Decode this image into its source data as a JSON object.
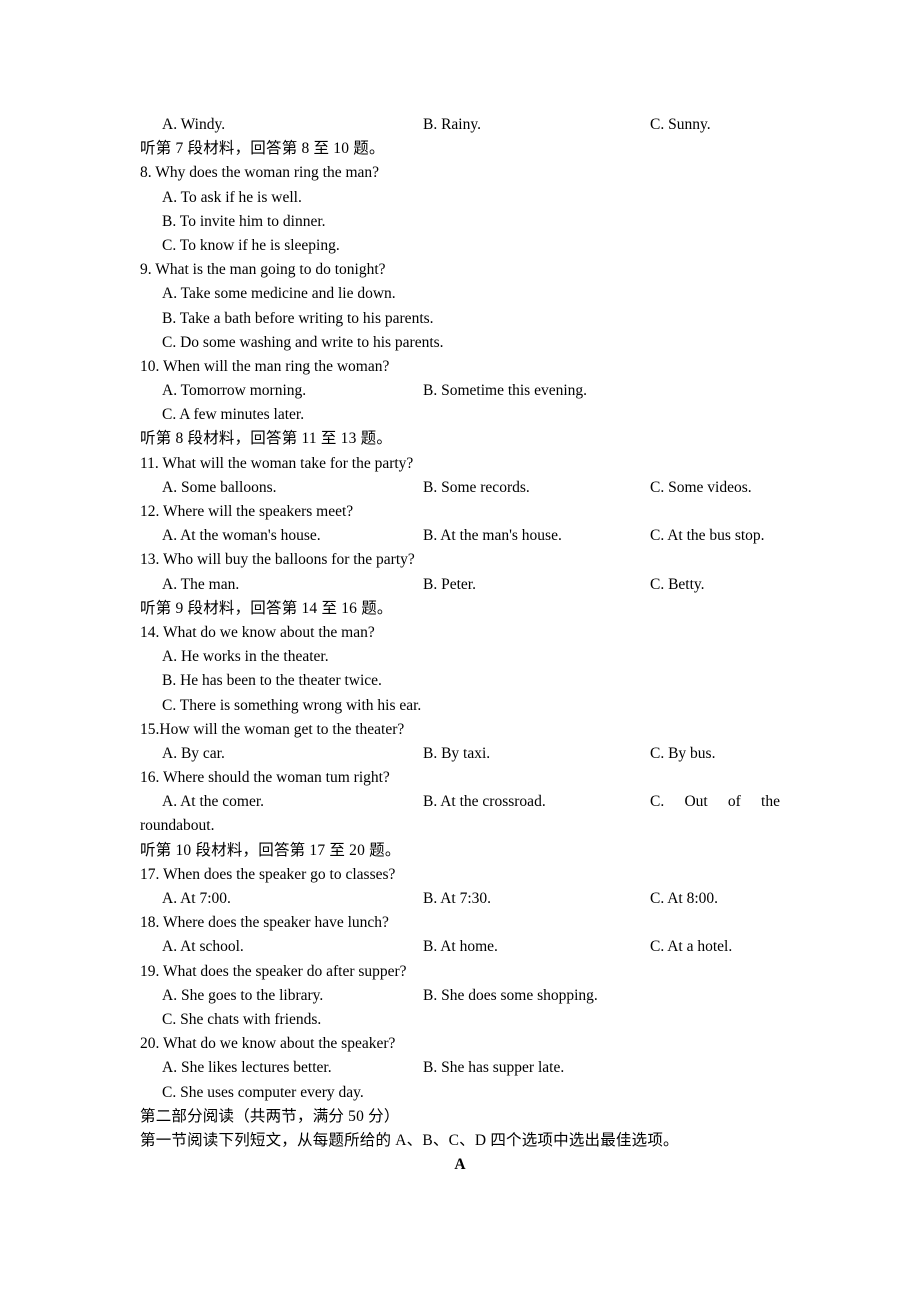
{
  "document": {
    "type": "english-exam-paper",
    "language_mix": "en-zh",
    "background_color": "#ffffff",
    "text_color": "#000000"
  },
  "top_options": {
    "a": "A. Windy.",
    "b": "B. Rainy.",
    "c": "C. Sunny."
  },
  "sections": [
    {
      "id": "material-7",
      "heading": "听第 7 段材料，回答第 8 至 10 题。",
      "questions": [
        {
          "number": "8",
          "stem": "8. Why does the woman ring the man?",
          "layout": "stacked",
          "options": [
            "A. To ask if he is well.",
            "B. To invite him to dinner.",
            "C. To know if he is sleeping."
          ]
        },
        {
          "number": "9",
          "stem": "9. What is the man going to do tonight?",
          "layout": "stacked",
          "options": [
            "A. Take some medicine and lie down.",
            "B. Take a bath before writing to his parents.",
            "C. Do some washing and write to his parents."
          ]
        },
        {
          "number": "10",
          "stem": "10. When will the man ring the woman?",
          "layout": "two-col-then-one",
          "options": [
            "A. Tomorrow morning.",
            "B. Sometime this evening.",
            "C. A few minutes later."
          ]
        }
      ]
    },
    {
      "id": "material-8",
      "heading": "听第 8 段材料，回答第 11 至 13 题。",
      "questions": [
        {
          "number": "11",
          "stem": "11. What will the woman take for the party?",
          "layout": "three-col",
          "options": [
            "A. Some balloons.",
            "B. Some records.",
            "C. Some videos."
          ]
        },
        {
          "number": "12",
          "stem": "12. Where will the speakers meet?",
          "layout": "three-col",
          "options": [
            "A. At the woman's house.",
            "B. At the man's house.",
            "C. At the bus stop."
          ]
        },
        {
          "number": "13",
          "stem": "13. Who will buy the balloons for the party?",
          "layout": "three-col",
          "options": [
            "A. The man.",
            "B. Peter.",
            "C. Betty."
          ]
        }
      ]
    },
    {
      "id": "material-9",
      "heading": "听第 9 段材料，回答第 14 至 16 题。",
      "questions": [
        {
          "number": "14",
          "stem": "14. What do we know about the man?",
          "layout": "stacked",
          "options": [
            "A. He works in the theater.",
            "B. He has been to the theater twice.",
            "C. There is something wrong with his ear."
          ]
        },
        {
          "number": "15",
          "stem": "15.How will the woman get to the theater?",
          "layout": "three-col",
          "options": [
            "A. By car.",
            "B. By taxi.",
            "C. By bus."
          ]
        },
        {
          "number": "16",
          "stem": "16. Where should the woman tum right?",
          "layout": "three-col-wrapped",
          "options": [
            "A. At the comer.",
            "B. At the crossroad.",
            "C. Out of the roundabout."
          ],
          "option_c_justified_words": [
            "C.",
            "Out",
            "of",
            "the"
          ],
          "option_c_wrapped_tail": "roundabout."
        }
      ]
    },
    {
      "id": "material-10",
      "heading": "听第 10 段材料，回答第 17 至 20 题。",
      "questions": [
        {
          "number": "17",
          "stem": "17. When does the speaker go to classes?",
          "layout": "three-col",
          "options": [
            "A. At 7:00.",
            "B. At 7:30.",
            "C. At 8:00."
          ]
        },
        {
          "number": "18",
          "stem": "18. Where does the speaker have lunch?",
          "layout": "three-col",
          "options": [
            "A. At school.",
            "B. At home.",
            "C. At a hotel."
          ]
        },
        {
          "number": "19",
          "stem": "19. What does the speaker do after supper?",
          "layout": "two-col-then-one",
          "options": [
            "A. She goes to the library.",
            "B. She does some shopping.",
            "C. She chats with friends."
          ]
        },
        {
          "number": "20",
          "stem": "20. What do we know about the speaker?",
          "layout": "two-col-then-one",
          "options": [
            "A. She likes lectures better.",
            "B. She has supper late.",
            "C. She uses computer every day."
          ]
        }
      ]
    }
  ],
  "part_two": {
    "part_heading": "第二部分阅读（共两节，满分 50 分）",
    "section_heading": "第一节阅读下列短文，从每题所给的 A、B、C、D 四个选项中选出最佳选项。",
    "passage_label": "A"
  }
}
